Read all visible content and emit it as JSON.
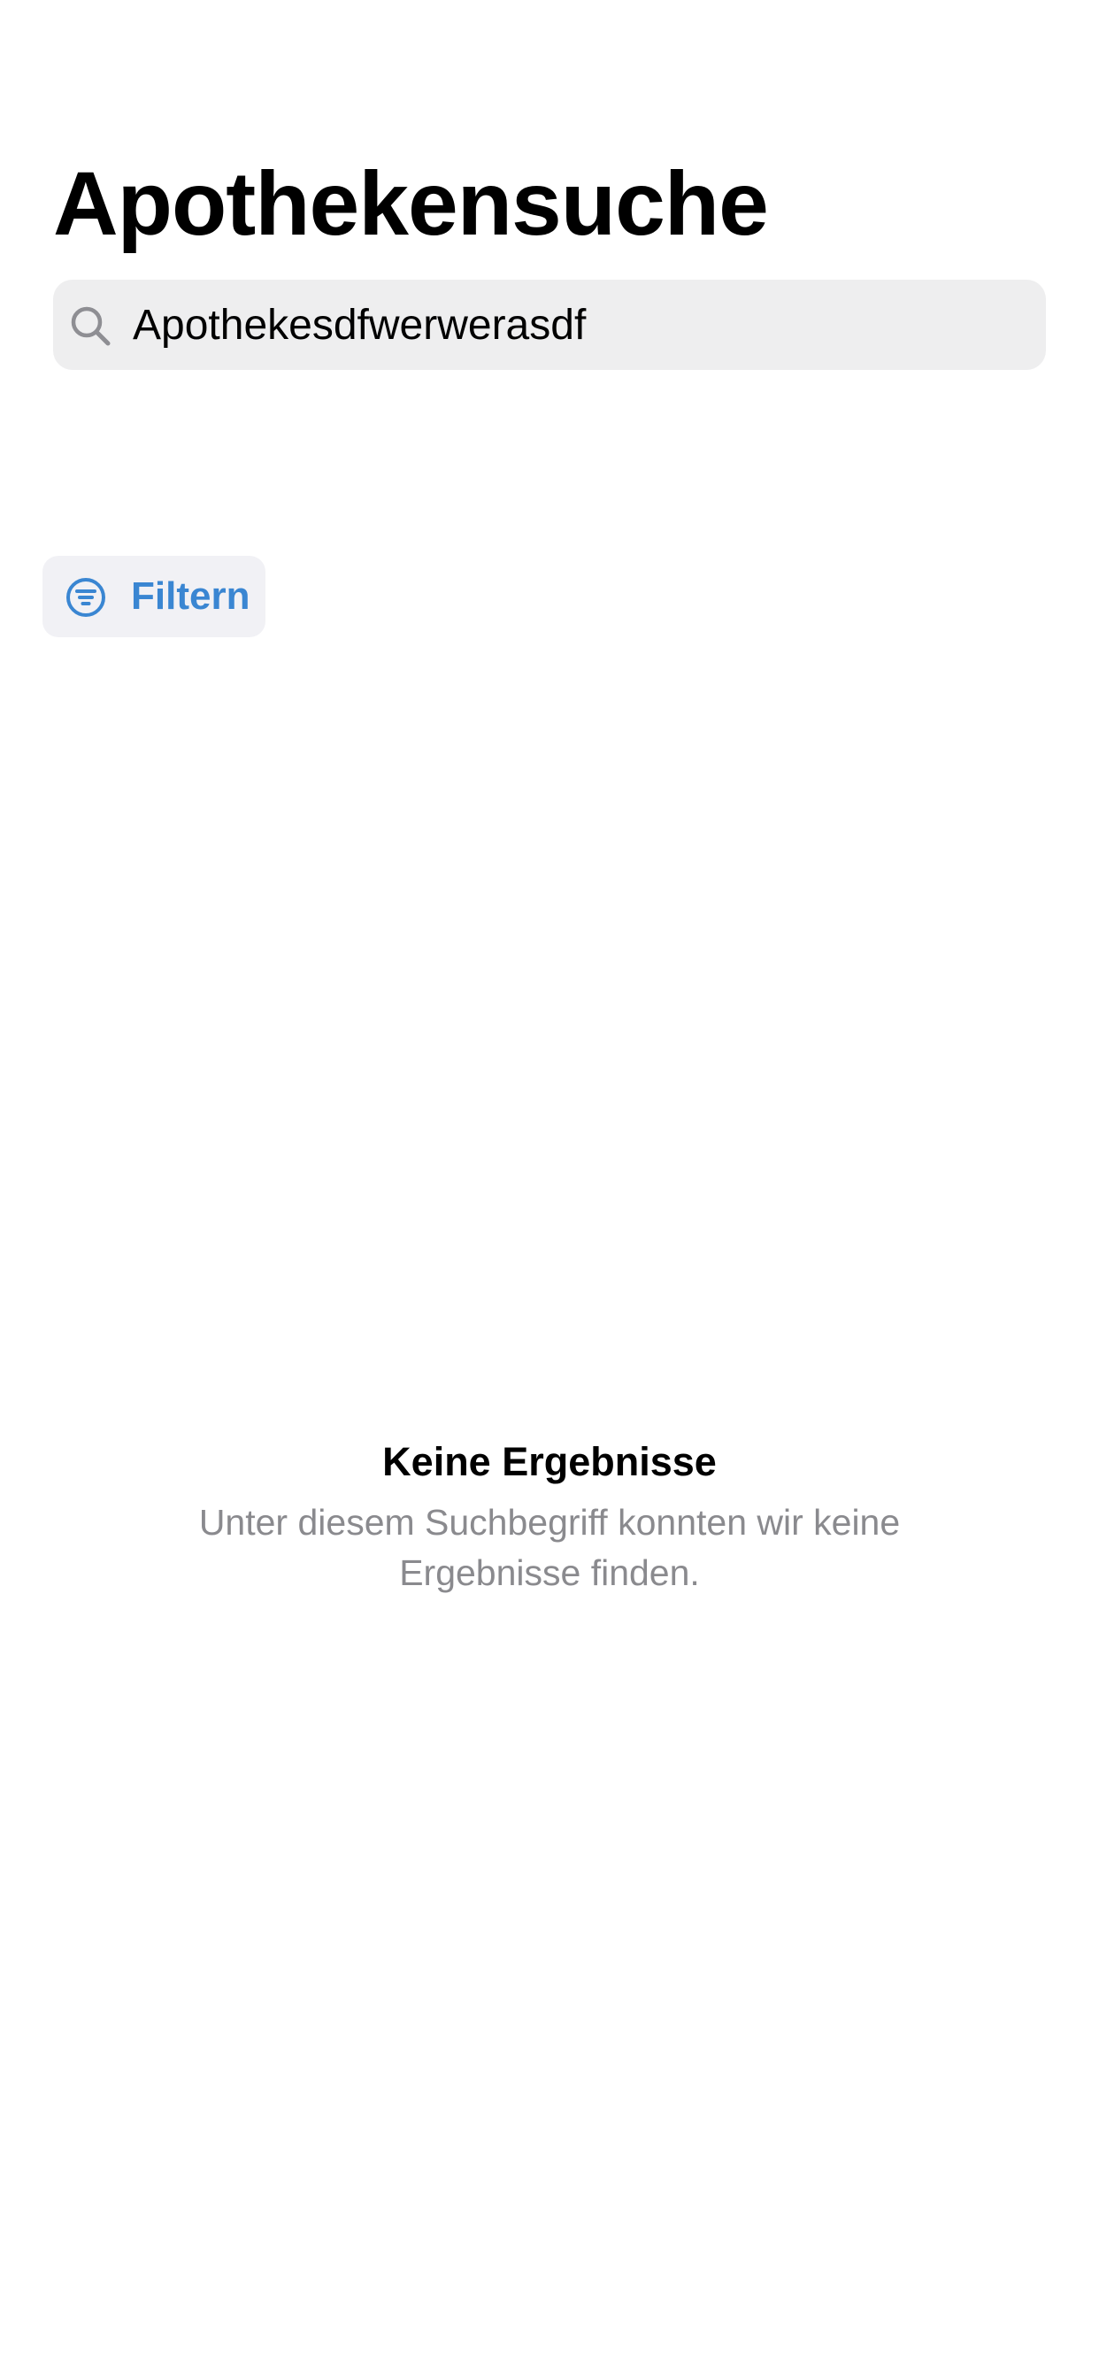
{
  "header": {
    "title": "Apothekensuche"
  },
  "search": {
    "value": "Apothekesdfwerwerasdf",
    "icon": "search-icon"
  },
  "filter": {
    "label": "Filtern",
    "icon": "filter-icon"
  },
  "empty_state": {
    "title": "Keine Ergebnisse",
    "message": "Unter diesem Suchbegriff konnten wir keine Ergebnisse finden."
  },
  "colors": {
    "accent": "#3a86d2",
    "search_background": "#eeeeef",
    "filter_background": "#f1f1f5",
    "secondary_text": "#8a8a8e"
  }
}
